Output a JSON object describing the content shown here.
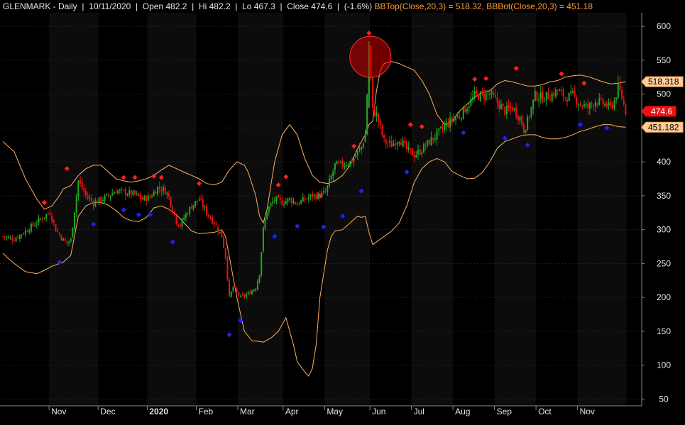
{
  "header": {
    "symbol": "GLENMARK - Daily",
    "date": "10/11/2020",
    "open": "Open 482.2",
    "high": "Hi 482.2",
    "low": "Lo 467.3",
    "close": "Close 474.6",
    "change": "(-1.6%)",
    "bbtop": "BBTop(Close,20,3) = 518.32,",
    "bbbot": "BBBot(Close,20,3) = 451.18"
  },
  "colors": {
    "background": "#000000",
    "up": "#22aa22",
    "down": "#ee1111",
    "band": "#ffb060",
    "peak_marker": "#ff2020",
    "trough_marker": "#2020ff",
    "grid": "#333333",
    "highlight_circle": "#cc0000"
  },
  "chart_data": {
    "type": "candlestick",
    "y_axis": {
      "ylim": [
        40,
        620
      ],
      "ticks": [
        50,
        100,
        150,
        200,
        250,
        300,
        350,
        400,
        450,
        500,
        550,
        600
      ],
      "tick_labels": [
        "50",
        "100",
        "150",
        "200",
        "250",
        "300",
        "350",
        "400",
        "450",
        "500",
        "550",
        "600"
      ]
    },
    "x_axis": {
      "month_labels": [
        "Nov",
        "Dec",
        "2020",
        "Feb",
        "Mar",
        "Apr",
        "May",
        "Jun",
        "Jul",
        "Aug",
        "Sep",
        "Oct",
        "Nov"
      ],
      "bold_labels": [
        "2020"
      ]
    },
    "price_labels": [
      {
        "value": 518.318,
        "text": "518.318",
        "style": "bbtop"
      },
      {
        "value": 474.6,
        "text": "474.6",
        "style": "close"
      },
      {
        "value": 451.182,
        "text": "451.182",
        "style": "bbbot"
      }
    ],
    "price_path": [
      [
        0,
        290
      ],
      [
        6,
        286
      ],
      [
        14,
        302
      ],
      [
        22,
        320
      ],
      [
        25,
        326
      ],
      [
        28,
        300
      ],
      [
        32,
        285
      ],
      [
        34,
        280
      ],
      [
        36,
        285
      ],
      [
        40,
        372
      ],
      [
        44,
        350
      ],
      [
        48,
        340
      ],
      [
        52,
        344
      ],
      [
        56,
        350
      ],
      [
        60,
        358
      ],
      [
        64,
        355
      ],
      [
        70,
        352
      ],
      [
        74,
        345
      ],
      [
        78,
        348
      ],
      [
        82,
        362
      ],
      [
        86,
        358
      ],
      [
        88,
        348
      ],
      [
        90,
        330
      ],
      [
        92,
        312
      ],
      [
        94,
        306
      ],
      [
        96,
        318
      ],
      [
        100,
        335
      ],
      [
        104,
        345
      ],
      [
        108,
        325
      ],
      [
        112,
        310
      ],
      [
        116,
        290
      ],
      [
        118,
        260
      ],
      [
        120,
        200
      ],
      [
        122,
        215
      ],
      [
        126,
        200
      ],
      [
        130,
        205
      ],
      [
        134,
        215
      ],
      [
        136,
        236
      ],
      [
        138,
        300
      ],
      [
        140,
        328
      ],
      [
        144,
        345
      ],
      [
        148,
        340
      ],
      [
        152,
        345
      ],
      [
        156,
        338
      ],
      [
        160,
        345
      ],
      [
        164,
        350
      ],
      [
        168,
        350
      ],
      [
        171,
        355
      ],
      [
        174,
        378
      ],
      [
        176,
        395
      ],
      [
        180,
        396
      ],
      [
        184,
        400
      ],
      [
        186,
        405
      ],
      [
        190,
        422
      ],
      [
        192,
        440
      ],
      [
        193,
        500
      ],
      [
        194,
        570
      ],
      [
        196,
        475
      ],
      [
        198,
        470
      ],
      [
        200,
        450
      ],
      [
        202,
        430
      ],
      [
        206,
        425
      ],
      [
        210,
        435
      ],
      [
        214,
        418
      ],
      [
        218,
        410
      ],
      [
        222,
        418
      ],
      [
        226,
        430
      ],
      [
        230,
        440
      ],
      [
        234,
        452
      ],
      [
        238,
        462
      ],
      [
        242,
        468
      ],
      [
        246,
        482
      ],
      [
        250,
        498
      ],
      [
        254,
        498
      ],
      [
        258,
        500
      ],
      [
        262,
        488
      ],
      [
        266,
        475
      ],
      [
        270,
        480
      ],
      [
        274,
        465
      ],
      [
        276,
        448
      ],
      [
        278,
        460
      ],
      [
        282,
        498
      ],
      [
        286,
        495
      ],
      [
        290,
        498
      ],
      [
        294,
        505
      ],
      [
        298,
        495
      ],
      [
        302,
        498
      ],
      [
        306,
        485
      ],
      [
        310,
        480
      ],
      [
        314,
        490
      ],
      [
        318,
        486
      ],
      [
        322,
        480
      ],
      [
        324,
        490
      ],
      [
        326,
        510
      ],
      [
        328,
        495
      ],
      [
        330,
        474.6
      ]
    ],
    "bb_upper": [
      [
        0,
        430
      ],
      [
        6,
        415
      ],
      [
        12,
        375
      ],
      [
        18,
        345
      ],
      [
        22,
        330
      ],
      [
        26,
        335
      ],
      [
        30,
        350
      ],
      [
        32,
        360
      ],
      [
        36,
        365
      ],
      [
        40,
        380
      ],
      [
        44,
        390
      ],
      [
        48,
        395
      ],
      [
        52,
        395
      ],
      [
        56,
        385
      ],
      [
        60,
        375
      ],
      [
        64,
        372
      ],
      [
        68,
        370
      ],
      [
        72,
        372
      ],
      [
        76,
        375
      ],
      [
        80,
        380
      ],
      [
        84,
        388
      ],
      [
        88,
        395
      ],
      [
        92,
        390
      ],
      [
        96,
        385
      ],
      [
        100,
        380
      ],
      [
        104,
        375
      ],
      [
        108,
        368
      ],
      [
        112,
        366
      ],
      [
        116,
        370
      ],
      [
        120,
        388
      ],
      [
        124,
        400
      ],
      [
        128,
        395
      ],
      [
        130,
        385
      ],
      [
        134,
        350
      ],
      [
        136,
        320
      ],
      [
        138,
        310
      ],
      [
        140,
        330
      ],
      [
        144,
        400
      ],
      [
        148,
        440
      ],
      [
        152,
        455
      ],
      [
        156,
        440
      ],
      [
        160,
        405
      ],
      [
        164,
        380
      ],
      [
        168,
        370
      ],
      [
        172,
        368
      ],
      [
        176,
        372
      ],
      [
        180,
        380
      ],
      [
        184,
        395
      ],
      [
        188,
        420
      ],
      [
        190,
        430
      ],
      [
        192,
        440
      ],
      [
        194,
        455
      ],
      [
        196,
        460
      ],
      [
        198,
        505
      ],
      [
        200,
        535
      ],
      [
        202,
        545
      ],
      [
        206,
        548
      ],
      [
        210,
        545
      ],
      [
        214,
        540
      ],
      [
        218,
        535
      ],
      [
        222,
        520
      ],
      [
        226,
        500
      ],
      [
        230,
        470
      ],
      [
        234,
        455
      ],
      [
        238,
        460
      ],
      [
        242,
        475
      ],
      [
        246,
        485
      ],
      [
        250,
        495
      ],
      [
        254,
        502
      ],
      [
        258,
        505
      ],
      [
        262,
        515
      ],
      [
        266,
        520
      ],
      [
        270,
        518
      ],
      [
        274,
        515
      ],
      [
        278,
        512
      ],
      [
        282,
        512
      ],
      [
        286,
        514
      ],
      [
        290,
        518
      ],
      [
        294,
        520
      ],
      [
        298,
        525
      ],
      [
        302,
        527
      ],
      [
        306,
        528
      ],
      [
        310,
        526
      ],
      [
        314,
        522
      ],
      [
        318,
        518
      ],
      [
        322,
        515
      ],
      [
        326,
        516
      ],
      [
        330,
        518.3
      ]
    ],
    "bb_lower": [
      [
        0,
        265
      ],
      [
        6,
        250
      ],
      [
        12,
        238
      ],
      [
        18,
        235
      ],
      [
        22,
        240
      ],
      [
        26,
        246
      ],
      [
        30,
        250
      ],
      [
        32,
        252
      ],
      [
        36,
        262
      ],
      [
        40,
        320
      ],
      [
        44,
        335
      ],
      [
        48,
        340
      ],
      [
        52,
        340
      ],
      [
        56,
        336
      ],
      [
        60,
        328
      ],
      [
        64,
        318
      ],
      [
        68,
        313
      ],
      [
        72,
        312
      ],
      [
        76,
        318
      ],
      [
        80,
        332
      ],
      [
        84,
        335
      ],
      [
        88,
        330
      ],
      [
        92,
        322
      ],
      [
        96,
        310
      ],
      [
        100,
        298
      ],
      [
        104,
        294
      ],
      [
        108,
        295
      ],
      [
        112,
        296
      ],
      [
        116,
        300
      ],
      [
        118,
        290
      ],
      [
        120,
        260
      ],
      [
        124,
        200
      ],
      [
        128,
        150
      ],
      [
        132,
        136
      ],
      [
        136,
        135
      ],
      [
        138,
        134
      ],
      [
        142,
        140
      ],
      [
        146,
        150
      ],
      [
        150,
        170
      ],
      [
        152,
        150
      ],
      [
        154,
        130
      ],
      [
        156,
        105
      ],
      [
        160,
        90
      ],
      [
        162,
        84
      ],
      [
        164,
        95
      ],
      [
        166,
        130
      ],
      [
        168,
        200
      ],
      [
        172,
        270
      ],
      [
        174,
        290
      ],
      [
        176,
        298
      ],
      [
        180,
        300
      ],
      [
        184,
        310
      ],
      [
        188,
        320
      ],
      [
        190,
        318
      ],
      [
        192,
        320
      ],
      [
        194,
        296
      ],
      [
        196,
        278
      ],
      [
        198,
        282
      ],
      [
        202,
        290
      ],
      [
        206,
        298
      ],
      [
        210,
        310
      ],
      [
        214,
        335
      ],
      [
        218,
        370
      ],
      [
        222,
        390
      ],
      [
        226,
        400
      ],
      [
        230,
        405
      ],
      [
        234,
        400
      ],
      [
        238,
        386
      ],
      [
        242,
        380
      ],
      [
        246,
        375
      ],
      [
        250,
        376
      ],
      [
        254,
        384
      ],
      [
        258,
        400
      ],
      [
        262,
        420
      ],
      [
        266,
        430
      ],
      [
        270,
        434
      ],
      [
        274,
        438
      ],
      [
        278,
        440
      ],
      [
        282,
        440
      ],
      [
        286,
        436
      ],
      [
        290,
        434
      ],
      [
        294,
        434
      ],
      [
        298,
        436
      ],
      [
        302,
        440
      ],
      [
        306,
        445
      ],
      [
        310,
        448
      ],
      [
        314,
        452
      ],
      [
        318,
        455
      ],
      [
        322,
        455
      ],
      [
        326,
        452
      ],
      [
        330,
        451.2
      ]
    ],
    "peak_markers": [
      [
        22,
        340
      ],
      [
        34,
        390
      ],
      [
        64,
        377
      ],
      [
        70,
        377
      ],
      [
        80,
        379
      ],
      [
        84,
        377
      ],
      [
        104,
        368
      ],
      [
        146,
        366
      ],
      [
        150,
        378
      ],
      [
        168,
        350
      ],
      [
        186,
        423
      ],
      [
        194,
        590
      ],
      [
        216,
        455
      ],
      [
        222,
        452
      ],
      [
        250,
        522
      ],
      [
        256,
        523
      ],
      [
        272,
        538
      ],
      [
        296,
        530
      ],
      [
        308,
        516
      ]
    ],
    "trough_markers": [
      [
        30,
        252
      ],
      [
        48,
        308
      ],
      [
        64,
        329
      ],
      [
        72,
        322
      ],
      [
        78,
        322
      ],
      [
        90,
        282
      ],
      [
        120,
        145
      ],
      [
        126,
        166
      ],
      [
        144,
        290
      ],
      [
        156,
        305
      ],
      [
        170,
        304
      ],
      [
        180,
        320
      ],
      [
        190,
        357
      ],
      [
        214,
        385
      ],
      [
        244,
        443
      ],
      [
        266,
        435
      ],
      [
        278,
        425
      ],
      [
        306,
        455
      ],
      [
        320,
        450
      ]
    ]
  }
}
